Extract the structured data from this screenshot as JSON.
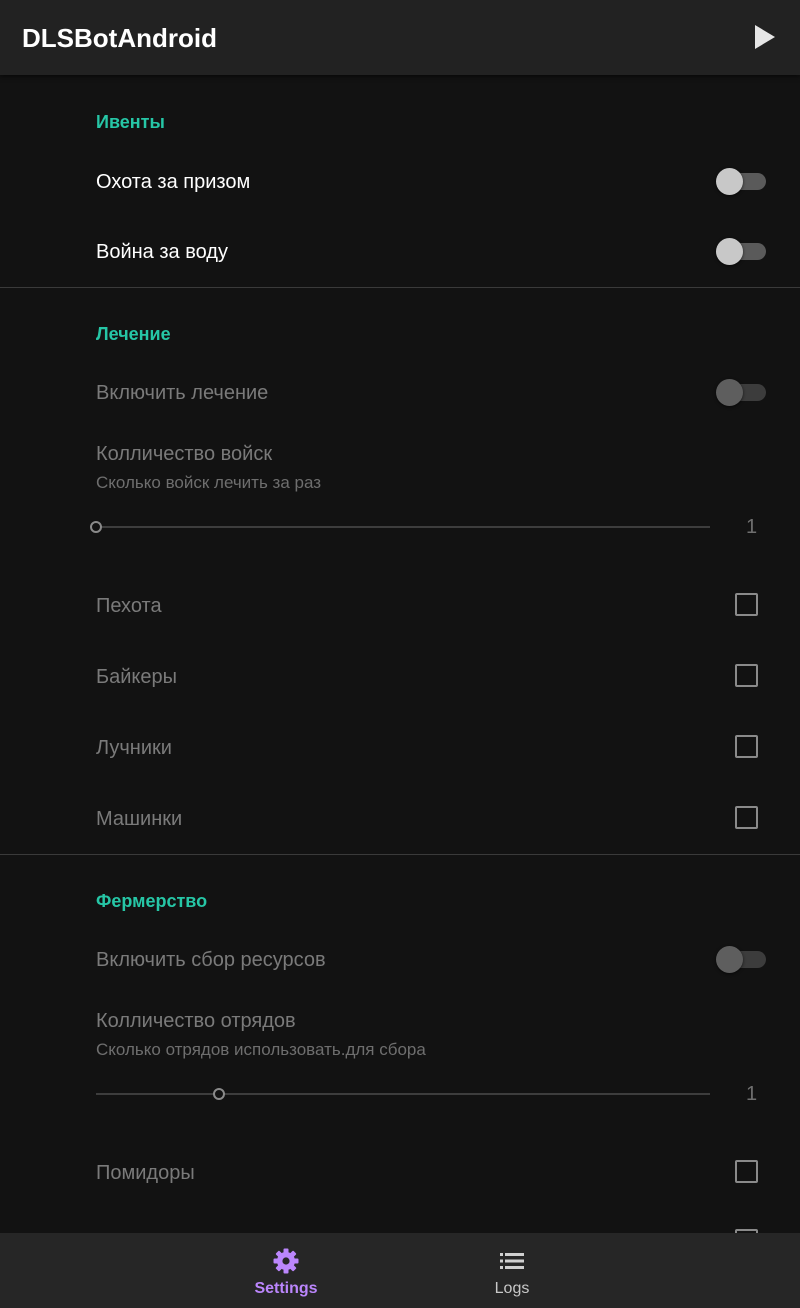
{
  "app": {
    "title": "DLSBotAndroid"
  },
  "events": {
    "title": "Ивенты",
    "items": [
      {
        "label": "Охота за призом",
        "enabled": false
      },
      {
        "label": "Война за воду",
        "enabled": false
      }
    ]
  },
  "healing": {
    "title": "Лечение",
    "enable": {
      "label": "Включить лечение",
      "enabled": false
    },
    "troops_count": {
      "label": "Колличество войск",
      "summary": "Сколько войск лечить за раз",
      "value": "1",
      "fraction": 0.0
    },
    "units": [
      {
        "label": "Пехота",
        "checked": false
      },
      {
        "label": "Байкеры",
        "checked": false
      },
      {
        "label": "Лучники",
        "checked": false
      },
      {
        "label": "Машинки",
        "checked": false
      }
    ]
  },
  "farming": {
    "title": "Фермерство",
    "enable": {
      "label": "Включить сбор ресурсов",
      "enabled": false
    },
    "squads_count": {
      "label": "Колличество отрядов",
      "summary": "Сколько отрядов использовать.для сбора",
      "value": "1",
      "fraction": 0.2
    },
    "resources": [
      {
        "label": "Помидоры",
        "checked": false
      }
    ]
  },
  "bottom_nav": {
    "items": [
      {
        "label": "Settings",
        "icon": "gear-icon",
        "active": true
      },
      {
        "label": "Logs",
        "icon": "list-icon",
        "active": false
      }
    ]
  },
  "colors": {
    "accent": "#26c6a6",
    "nav_active": "#bb86fc",
    "background": "#121212",
    "appbar": "#222222"
  }
}
